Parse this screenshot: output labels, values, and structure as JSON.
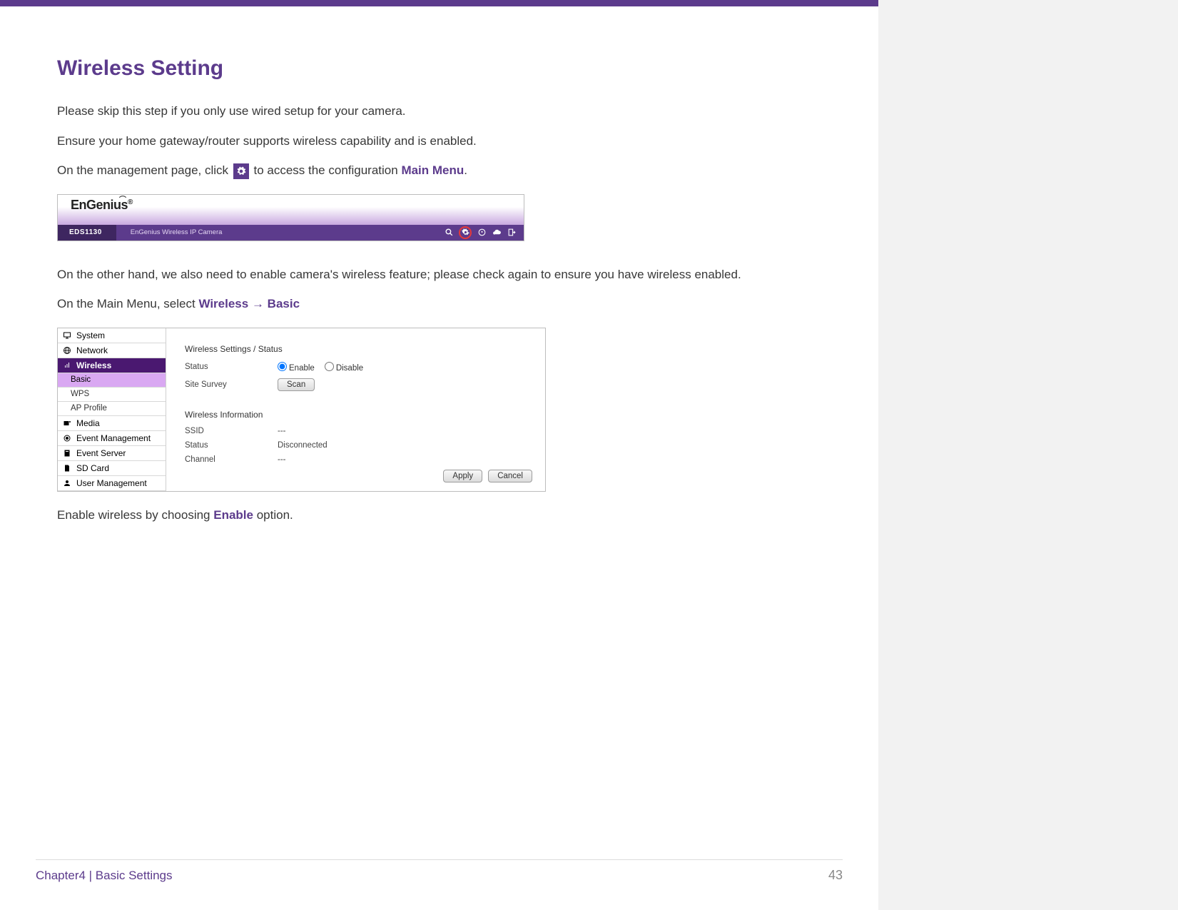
{
  "heading": "Wireless Setting",
  "p1": "Please skip this step if you only use wired setup for your camera.",
  "p2": "Ensure your home gateway/router supports wireless capability and is enabled.",
  "p3_a": "On the management page, click ",
  "p3_b": " to access the configuration ",
  "p3_main_menu": "Main Menu",
  "p3_c": ".",
  "p4": "On the other hand, we also need to enable camera's wireless feature; please check again to ensure you have wireless enabled.",
  "p5_a": "On the Main Menu, select ",
  "p5_wireless": "Wireless",
  "p5_arrow": " → ",
  "p5_basic": "Basic",
  "p6_a": "Enable wireless by choosing ",
  "p6_enable": "Enable",
  "p6_b": " option.",
  "shot1": {
    "brand": "EnGenius",
    "reg": "®",
    "model": "EDS1130",
    "device_label": "EnGenius Wireless IP Camera"
  },
  "shot2": {
    "sidebar": {
      "system": "System",
      "network": "Network",
      "wireless": "Wireless",
      "basic": "Basic",
      "wps": "WPS",
      "ap_profile": "AP Profile",
      "media": "Media",
      "event_mgmt": "Event Management",
      "event_server": "Event Server",
      "sd_card": "SD Card",
      "user_mgmt": "User Management"
    },
    "content": {
      "settings_title": "Wireless Settings / Status",
      "status_label": "Status",
      "enable": "Enable",
      "disable": "Disable",
      "site_survey_label": "Site Survey",
      "scan_btn": "Scan",
      "info_title": "Wireless Information",
      "ssid_label": "SSID",
      "ssid_value": "---",
      "status2_label": "Status",
      "status2_value": "Disconnected",
      "channel_label": "Channel",
      "channel_value": "---",
      "apply_btn": "Apply",
      "cancel_btn": "Cancel"
    }
  },
  "footer": {
    "chapter": "Chapter4  |  Basic Settings",
    "page_num": "43"
  }
}
